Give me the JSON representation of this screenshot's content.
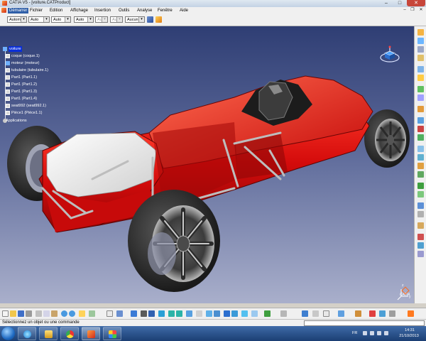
{
  "window": {
    "title": "CATIA V5 - [voiture.CATProduct]",
    "minimize_glyph": "–",
    "maximize_glyph": "□",
    "close_glyph": "✕"
  },
  "menu": {
    "items": [
      "Démarrer",
      "Fichier",
      "Edition",
      "Affichage",
      "Insertion",
      "Outils",
      "Analyse",
      "Fenêtre",
      "Aide"
    ],
    "active": "Démarrer"
  },
  "format_toolbar": {
    "combos": [
      {
        "value": "Autom.",
        "enabled": true
      },
      {
        "value": "Auto",
        "enabled": true
      },
      {
        "value": "Auto",
        "enabled": true
      },
      {
        "value": "Auto",
        "enabled": true
      },
      {
        "value": "Aut",
        "enabled": false
      },
      {
        "value": "Aut",
        "enabled": false
      },
      {
        "value": "Aucun",
        "enabled": true
      }
    ],
    "icons": [
      "thickness-icon",
      "color-icon",
      "layer-icon",
      "paint-icon",
      "properties-icon"
    ]
  },
  "spec_tree": {
    "root": "voiture",
    "children": [
      "coque (coque.1)",
      "moteur (moteur)",
      "tubulaire (tubulaire.1)",
      "Part1 (Part1.1)",
      "Part1 (Part1.2)",
      "Part1 (Part1.3)",
      "Part1 (Part1.4)",
      "seat992 (seat992.1)",
      "Pièce1 (Pièce1.1)"
    ],
    "footer": "Applications"
  },
  "viewport": {
    "compass": "compass-icon",
    "axis": "axis-system-icon",
    "brand": "CATIA",
    "colors": {
      "background_top": "#2f3e74",
      "background_bottom": "#a9afcb",
      "body": "#d40b0b",
      "tyre": "#2a2a2a",
      "rim": "#9a9a9a",
      "white_panel": "#f2f2f2"
    }
  },
  "right_toolbar": {
    "icons": [
      "product-icon",
      "component-icon",
      "existing-component-icon",
      "replace-icon",
      "graph-tree-icon",
      "fix-icon",
      "constraint-icon",
      "snap-icon",
      "explode-icon",
      "manipulation-icon",
      "stop-icon",
      "update-icon",
      "offset-icon",
      "contact-icon",
      "angle-icon",
      "coincidence-icon",
      "fix-together-icon",
      "quick-constraint-icon",
      "flexible-icon",
      "change-constraint-icon",
      "reuse-pattern-icon",
      "clash-icon",
      "section-icon",
      "distance-icon"
    ]
  },
  "bottom_toolbar": {
    "icons": [
      "new-icon",
      "open-icon",
      "save-icon",
      "print-icon",
      "cut-icon",
      "copy-icon",
      "paste-icon",
      "undo-icon",
      "redo-icon",
      "whats-this-icon",
      "analyze-icon",
      "catalog-icon",
      "formula-icon",
      "fly-icon",
      "fit-all-icon",
      "pan-icon",
      "rotate-icon",
      "zoom-in-icon",
      "zoom-out-icon",
      "normal-view-icon",
      "iso-view-icon",
      "shading-icon",
      "hide-show-icon",
      "swap-icon",
      "measure-icon",
      "lock-icon",
      "grid-icon",
      "sketch-icon",
      "tools-icon",
      "manip-icon"
    ]
  },
  "status": {
    "message": "Sélectionnez un objet ou une commande",
    "input_value": ""
  },
  "taskbar": {
    "apps": [
      "ie-icon",
      "explorer-icon",
      "chrome-icon",
      "catia-icon",
      "windows-media-icon"
    ],
    "language": "FR",
    "time": "14:31",
    "date": "21/10/2013"
  }
}
